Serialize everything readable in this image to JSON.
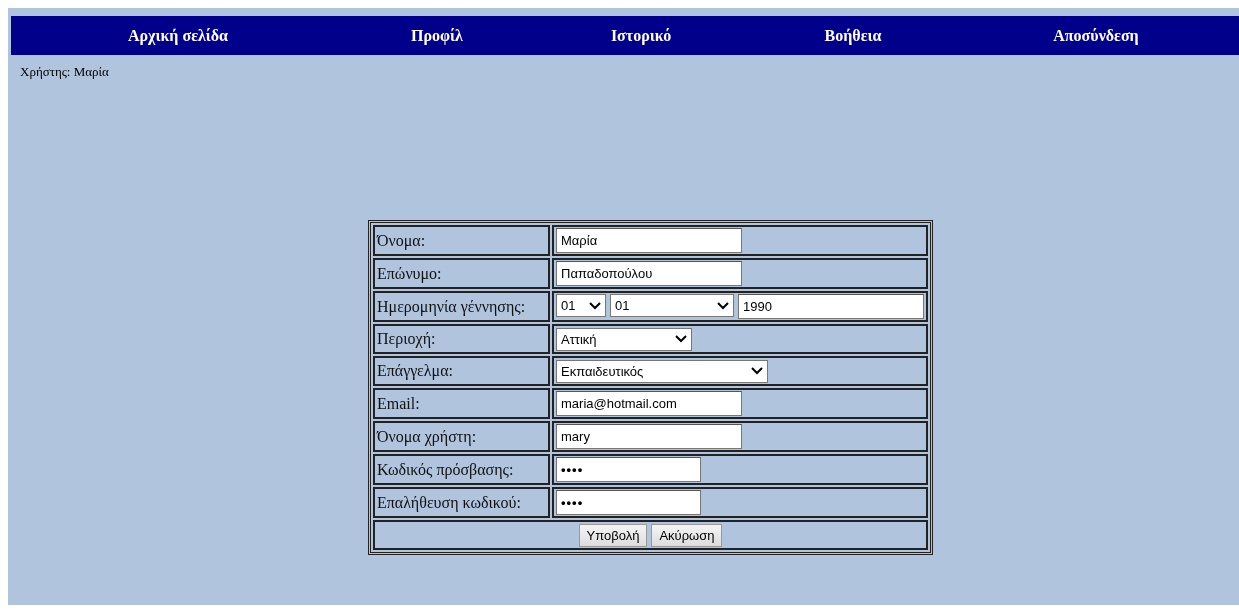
{
  "nav": [
    {
      "label": "Αρχική σελίδα"
    },
    {
      "label": "Προφίλ"
    },
    {
      "label": "Ιστορικό"
    },
    {
      "label": "Βοήθεια"
    },
    {
      "label": "Αποσύνδεση"
    }
  ],
  "user_line": "Χρήστης: Μαρία",
  "form": {
    "rows": [
      {
        "label": "Όνομα:",
        "kind": "text",
        "value": "Μαρία"
      },
      {
        "label": "Επώνυμο:",
        "kind": "text",
        "value": "Παπαδοπούλου"
      },
      {
        "label": "Ημερομηνία γέννησης:",
        "kind": "date",
        "parts": [
          {
            "kind": "select",
            "value": "01"
          },
          {
            "kind": "select",
            "value": "01"
          },
          {
            "kind": "text",
            "value": "1990"
          }
        ]
      },
      {
        "label": "Περιοχή:",
        "kind": "select",
        "value": "Αττική"
      },
      {
        "label": "Επάγγελμα:",
        "kind": "select",
        "value": "Εκπαιδευτικός"
      },
      {
        "label": "Email:",
        "kind": "text",
        "value": "maria@hotmail.com"
      },
      {
        "label": "Όνομα χρήστη:",
        "kind": "text",
        "value": "mary"
      },
      {
        "label": "Κωδικός πρόσβασης:",
        "kind": "password",
        "value": "••••"
      },
      {
        "label": "Επαλήθευση κωδικού:",
        "kind": "password",
        "value": "••••"
      }
    ],
    "buttons": [
      "Υποβολή",
      "Ακύρωση"
    ]
  }
}
